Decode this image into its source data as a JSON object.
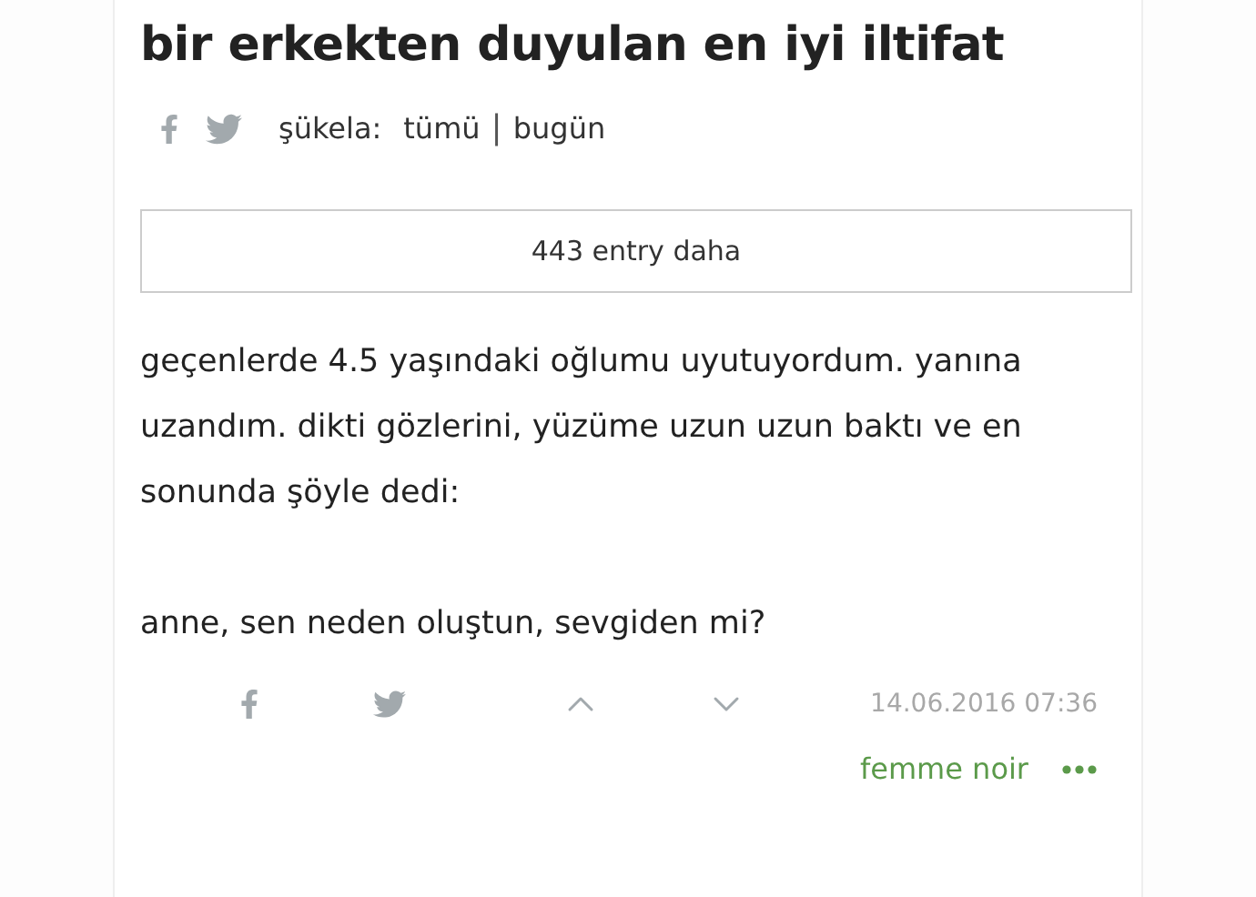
{
  "topic": {
    "title": "bir erkekten duyulan en iyi iltifat"
  },
  "filters": {
    "label": "şükela:",
    "options": [
      {
        "label": "tümü",
        "selected": false
      },
      {
        "label": "bugün",
        "selected": false
      }
    ],
    "separator": "|"
  },
  "more_button": {
    "label": "443 entry daha"
  },
  "entry": {
    "paragraphs": [
      "geçenlerde 4.5 yaşındaki oğlumu uyutuyordum. yanına uzandım. dikti gözlerini, yüzüme uzun uzun baktı ve en sonunda şöyle dedi:",
      "anne, sen neden oluştun, sevgiden mi?"
    ],
    "date": "14.06.2016 07:36",
    "author": "femme noir"
  }
}
